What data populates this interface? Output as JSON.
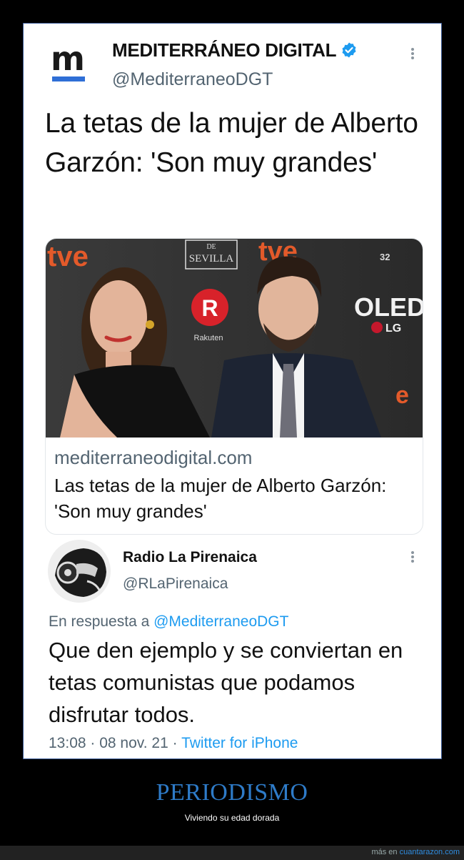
{
  "tweet1": {
    "author_name": "MEDITERRÁNEO DIGITAL",
    "handle": "@MediterraneoDGT",
    "avatar_letter": "m",
    "body": "La tetas de la mujer de Alberto Garzón: 'Son muy grandes'",
    "card": {
      "domain": "mediterraneodigital.com",
      "title": "Las tetas de la mujer de Alberto Garzón: 'Son muy grandes'"
    },
    "photo_texts": {
      "sevilla": "SEVILLA",
      "de": "DE",
      "rakuten": "Rakuten",
      "oled": "OLED",
      "lg": "LG",
      "num": "32",
      "r": "R",
      "tve": "tve"
    }
  },
  "tweet2": {
    "author_name": "Radio La Pirenaica",
    "handle": "@RLaPirenaica",
    "reply_prefix": "En respuesta a ",
    "reply_handle": "@MediterraneoDGT",
    "body": "Que den ejemplo y se conviertan en tetas comunistas que podamos disfrutar todos.",
    "time": "13:08",
    "date": "08 nov. 21",
    "source": "Twitter for iPhone",
    "separator": " · "
  },
  "caption": {
    "title": "PERIODISMO",
    "subtitle": "Viviendo su edad dorada"
  },
  "footer": {
    "prefix": "más en ",
    "site": "cuantarazon.com"
  },
  "colors": {
    "verified": "#1d9bf0",
    "link": "#1d9bf0",
    "caption": "#2e7bc8",
    "frame_border": "#3b5b98"
  }
}
